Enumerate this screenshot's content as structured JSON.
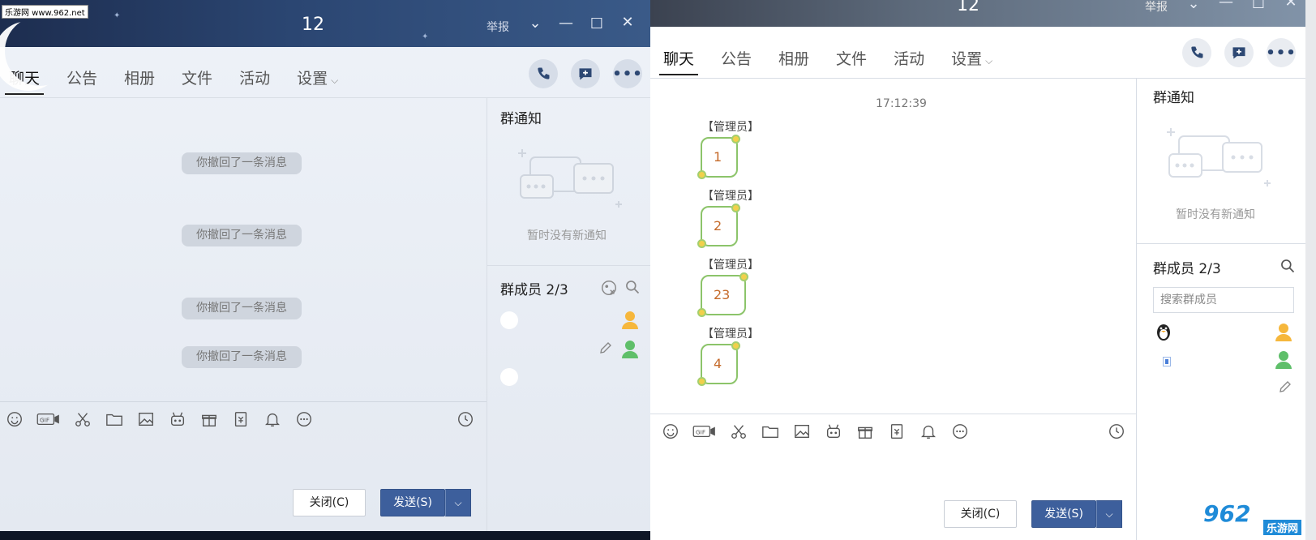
{
  "watermark": "乐游网 www.962.net",
  "left_window": {
    "title": "12",
    "report": "举报",
    "tabs": [
      "聊天",
      "公告",
      "相册",
      "文件",
      "活动",
      "设置"
    ],
    "recalled": [
      "你撤回了一条消息",
      "你撤回了一条消息",
      "你撤回了一条消息",
      "你撤回了一条消息"
    ],
    "notice_title": "群通知",
    "notice_empty": "暂时没有新通知",
    "members_title": "群成员 2/3",
    "close_label": "关闭(C)",
    "send_label": "发送(S)"
  },
  "right_window": {
    "title": "12",
    "report": "举报",
    "tabs": [
      "聊天",
      "公告",
      "相册",
      "文件",
      "活动",
      "设置"
    ],
    "timestamp": "17:12:39",
    "messages": [
      {
        "sender": "【管理员】",
        "text": "1"
      },
      {
        "sender": "【管理员】",
        "text": "2"
      },
      {
        "sender": "【管理员】",
        "text": "23"
      },
      {
        "sender": "【管理员】",
        "text": "4"
      }
    ],
    "notice_title": "群通知",
    "notice_empty": "暂时没有新通知",
    "members_title": "群成员 2/3",
    "search_placeholder": "搜索群成员",
    "close_label": "关闭(C)",
    "send_label": "发送(S)"
  },
  "brand": {
    "logo_text": "962",
    "logo_sub": "乐游网"
  },
  "colors": {
    "accent": "#3d5f9c",
    "bubble_border": "#8cc46a",
    "bubble_text": "#c56a2a"
  },
  "icons": [
    "emoji-icon",
    "gif-icon",
    "scissors-icon",
    "folder-icon",
    "image-icon",
    "robot-icon",
    "gift-icon",
    "lucky-bag-icon",
    "bell-icon",
    "more-icon",
    "history-icon",
    "phone-icon",
    "add-chat-icon",
    "ellipsis-icon",
    "search-icon",
    "pencil-icon",
    "penguin-icon",
    "avatar-icon"
  ]
}
